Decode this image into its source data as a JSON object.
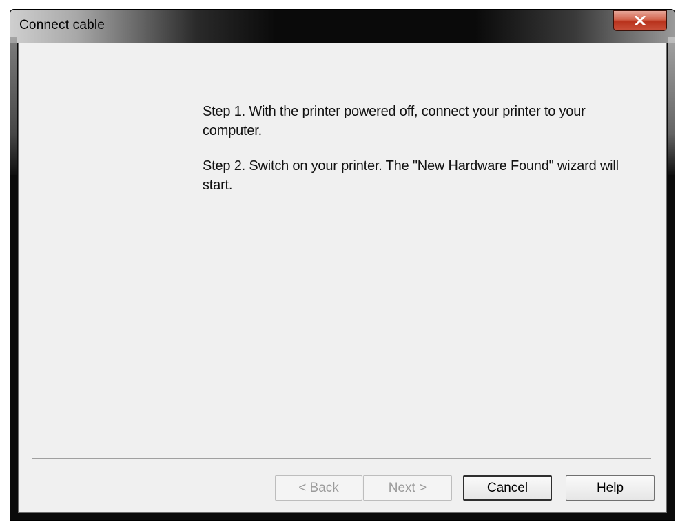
{
  "window": {
    "title": "Connect cable",
    "close_icon": "close-x-icon"
  },
  "content": {
    "steps": [
      "Step 1. With the printer powered off, connect your printer to your computer.",
      "Step 2. Switch on your printer. The \"New Hardware Found\" wizard will start."
    ]
  },
  "buttons": {
    "back": "< Back",
    "next": "Next >",
    "cancel": "Cancel",
    "help": "Help"
  }
}
